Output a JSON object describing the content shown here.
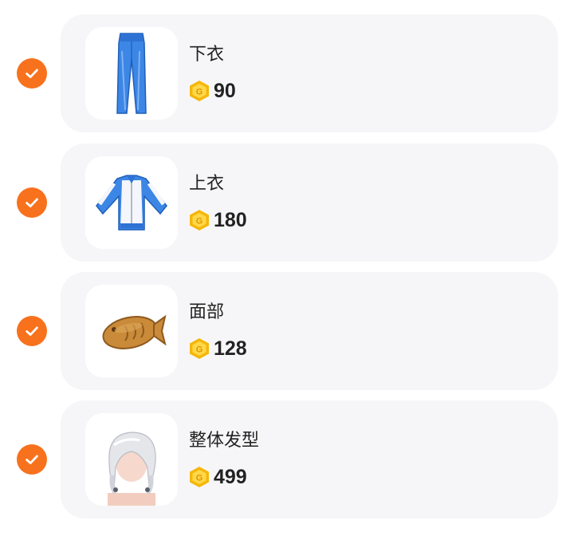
{
  "theme": {
    "accent": "#f8711d",
    "card_bg": "#f6f6f8",
    "coin_gold": "#f5b70a"
  },
  "items": [
    {
      "name": "下衣",
      "price": "90",
      "thumbnail": "blue-track-pants",
      "selected": true
    },
    {
      "name": "上衣",
      "price": "180",
      "thumbnail": "blue-white-track-jacket",
      "selected": true
    },
    {
      "name": "面部",
      "price": "128",
      "thumbnail": "taiyaki-fish",
      "selected": true
    },
    {
      "name": "整体发型",
      "price": "499",
      "thumbnail": "silver-hairstyle",
      "selected": true
    }
  ],
  "icons": {
    "check": "check-icon",
    "coin": "coin-icon"
  }
}
